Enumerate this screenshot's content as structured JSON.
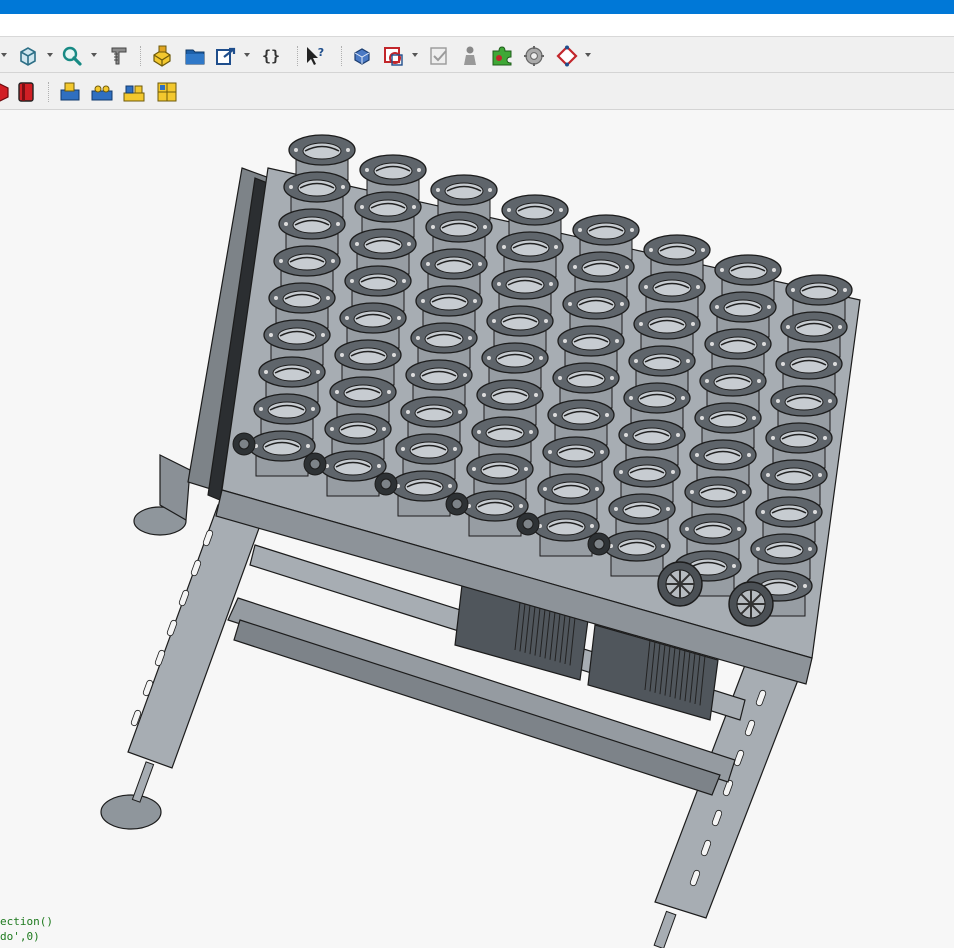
{
  "toolbar1": {
    "items": [
      {
        "name": "view-dropdown-arrow",
        "icon": "chevron-down-icon",
        "kind": "drop"
      },
      {
        "name": "std-views-cube",
        "icon": "cube-view-icon",
        "kind": "icon"
      },
      {
        "name": "std-views-dropdown",
        "icon": "chevron-down-icon",
        "kind": "drop"
      },
      {
        "name": "zoom",
        "icon": "zoom-icon",
        "kind": "icon"
      },
      {
        "name": "zoom-dropdown",
        "icon": "chevron-down-icon",
        "kind": "drop"
      },
      {
        "name": "measure",
        "icon": "caliper-icon",
        "kind": "icon"
      },
      {
        "name": "part",
        "icon": "part-icon",
        "kind": "icon"
      },
      {
        "name": "group",
        "icon": "folder-icon",
        "kind": "icon"
      },
      {
        "name": "link",
        "icon": "link-icon",
        "kind": "icon"
      },
      {
        "name": "link-dropdown",
        "icon": "chevron-down-icon",
        "kind": "drop"
      },
      {
        "name": "macro",
        "icon": "braces-icon",
        "kind": "icon"
      },
      {
        "name": "whats-this",
        "icon": "whats-this-icon",
        "kind": "icon"
      },
      {
        "name": "body",
        "icon": "body-icon",
        "kind": "icon"
      },
      {
        "name": "sketch",
        "icon": "sketch-icon",
        "kind": "icon"
      },
      {
        "name": "sketch-dropdown",
        "icon": "chevron-down-icon",
        "kind": "drop"
      },
      {
        "name": "validate",
        "icon": "validate-icon",
        "kind": "icon"
      },
      {
        "name": "person",
        "icon": "person-icon",
        "kind": "icon"
      },
      {
        "name": "puzzle",
        "icon": "puzzle-icon",
        "kind": "icon"
      },
      {
        "name": "gear-head",
        "icon": "gear-head-icon",
        "kind": "icon"
      },
      {
        "name": "diamond",
        "icon": "diamond-icon",
        "kind": "icon"
      },
      {
        "name": "diamond-dropdown",
        "icon": "chevron-down-icon",
        "kind": "drop"
      }
    ]
  },
  "toolbar2": {
    "items": [
      {
        "name": "red-cube-a",
        "icon": "red-cube-icon"
      },
      {
        "name": "red-cube-b",
        "icon": "red-book-icon"
      },
      {
        "name": "assembly-insert",
        "icon": "assembly-insert-icon"
      },
      {
        "name": "assembly-constraint",
        "icon": "assembly-constraint-icon"
      },
      {
        "name": "assembly-pattern",
        "icon": "assembly-pattern-icon"
      },
      {
        "name": "assembly-stack",
        "icon": "assembly-stack-icon"
      }
    ]
  },
  "console": {
    "line1": "ection()",
    "line2": "do',0)"
  },
  "colors": {
    "titlebar": "#0078d7",
    "steel": "#a7adb3",
    "steel_dark": "#6e747a",
    "outline": "#1c1c1c",
    "background": "#f7f7f7"
  }
}
